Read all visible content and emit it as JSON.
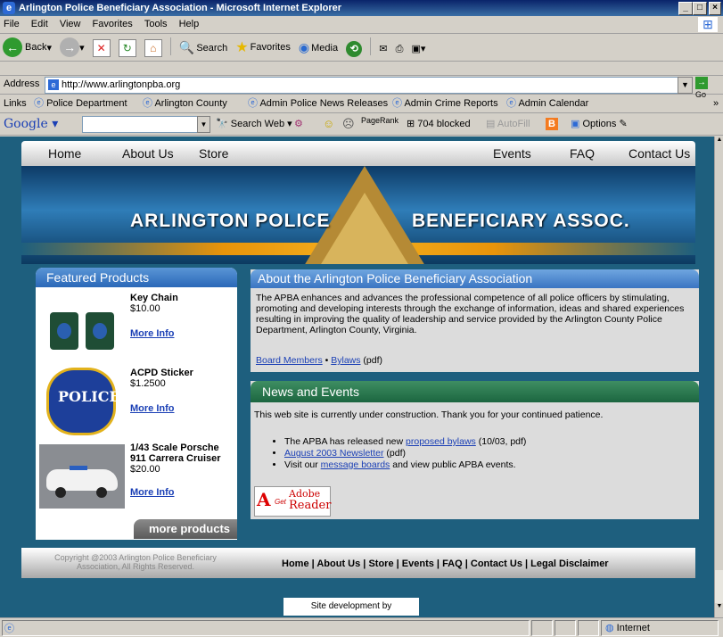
{
  "window": {
    "title": "Arlington Police Beneficiary Association - Microsoft Internet Explorer"
  },
  "menu": [
    "File",
    "Edit",
    "View",
    "Favorites",
    "Tools",
    "Help"
  ],
  "toolbar": {
    "back": "Back",
    "search": "Search",
    "favorites": "Favorites",
    "media": "Media"
  },
  "address": {
    "label": "Address",
    "url": "http://www.arlingtonpba.org",
    "go": "Go"
  },
  "links": {
    "label": "Links",
    "items": [
      "Police Department",
      "Arlington County",
      "Admin Police News Releases",
      "Admin Crime Reports",
      "Admin Calendar"
    ]
  },
  "google": {
    "brand": "Google",
    "search_web": "Search Web",
    "pagerank": "PageRank",
    "blocked": "704 blocked",
    "autofill": "AutoFill",
    "options": "Options"
  },
  "site": {
    "nav": [
      "Home",
      "About Us",
      "Store",
      "Events",
      "FAQ",
      "Contact Us"
    ],
    "banner_left": "ARLINGTON POLICE",
    "banner_right": "BENEFICIARY ASSOC."
  },
  "featured": {
    "title": "Featured Products",
    "products": [
      {
        "name": "Key Chain",
        "price": "$10.00",
        "link": "More Info"
      },
      {
        "name": "ACPD Sticker",
        "price": "$1.2500",
        "link": "More Info"
      },
      {
        "name": "1/43 Scale Porsche 911 Carrera Cruiser",
        "price": "$20.00",
        "link": "More Info"
      }
    ],
    "more": "more products"
  },
  "about": {
    "title": "About the Arlington Police Beneficiary Association",
    "body": "The APBA enhances and advances the professional competence of all police officers by stimulating, promoting and developing interests through the exchange of information, ideas and shared experiences resulting in improving the quality of leadership and service provided by the Arlington County Police Department, Arlington County, Virginia.",
    "link1": "Board Members",
    "link2": "Bylaws",
    "suffix": "(pdf)"
  },
  "news": {
    "title": "News and Events",
    "intro": "This web site is currently under construction. Thank you for your continued patience.",
    "item1_pre": "The APBA has released new ",
    "item1_link": "proposed bylaws",
    "item1_post": " (10/03, pdf)",
    "item2_link": "August 2003 Newsletter",
    "item2_post": " (pdf)",
    "item3_pre": "Visit our ",
    "item3_link": "message boards",
    "item3_post": " and view public APBA events.",
    "adobe_get": "Get",
    "adobe_brand": "Adobe",
    "adobe_reader": "Reader"
  },
  "footer": {
    "copyright": "Copyright @2003 Arlington Police Beneficiary Association, All Rights Reserved.",
    "links": [
      "Home",
      "About Us",
      "Store",
      "Events",
      "FAQ",
      "Contact Us",
      "Legal Disclaimer"
    ],
    "sitedev": "Site development by"
  },
  "status": {
    "zone": "Internet"
  }
}
